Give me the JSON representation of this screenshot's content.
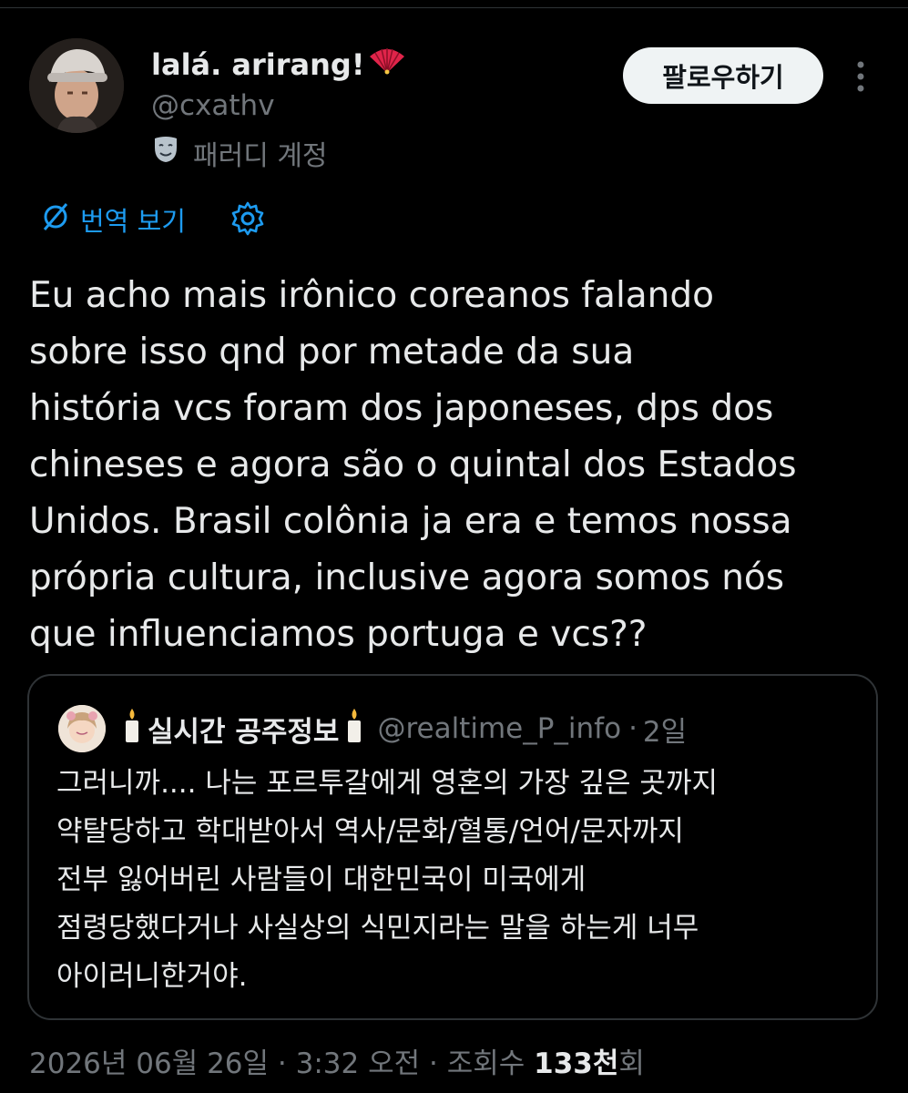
{
  "author": {
    "display_name": "lalá. arirang!",
    "name_emoji": "fan-icon",
    "handle": "@cxathv",
    "parody_label": "패러디 계정",
    "parody_icon": "theater-mask-icon"
  },
  "actions": {
    "follow_label": "팔로우하기",
    "more_icon": "more-vertical-icon"
  },
  "translate": {
    "label": "번역 보기",
    "icon": "translate-icon",
    "settings_icon": "gear-icon"
  },
  "tweet": {
    "lines": [
      "Eu acho mais irônico coreanos falando",
      "sobre isso qnd por metade da sua",
      "história vcs foram dos japoneses, dps dos",
      "chineses e agora são o quintal dos Estados",
      "Unidos. Brasil colônia ja era e temos nossa",
      "própria cultura, inclusive agora somos nós",
      "que influenciamos portuga e vcs??"
    ]
  },
  "quote": {
    "name": "실시간 공주정보",
    "name_emoji": "candle-icon",
    "handle": "@realtime_P_info",
    "time": "2일",
    "lines": [
      "그러니까.... 나는 포르투갈에게 영혼의 가장 깊은 곳까지",
      "약탈당하고 학대받아서 역사/문화/혈통/언어/문자까지",
      "전부 잃어버린 사람들이 대한민국이 미국에게",
      "점령당했다거나 사실상의 식민지라는 말을 하는게 너무",
      "아이러니한거야."
    ]
  },
  "meta": {
    "date": "2026년 06월 26일",
    "time": "3:32 오전",
    "views_label": "조회수",
    "views_count": "133천",
    "views_suffix": "회"
  },
  "colors": {
    "background": "#000000",
    "text": "#e7e9ea",
    "secondary": "#71767b",
    "accent": "#1d9bf0",
    "border": "#2f3336",
    "follow_bg": "#eff3f4"
  }
}
